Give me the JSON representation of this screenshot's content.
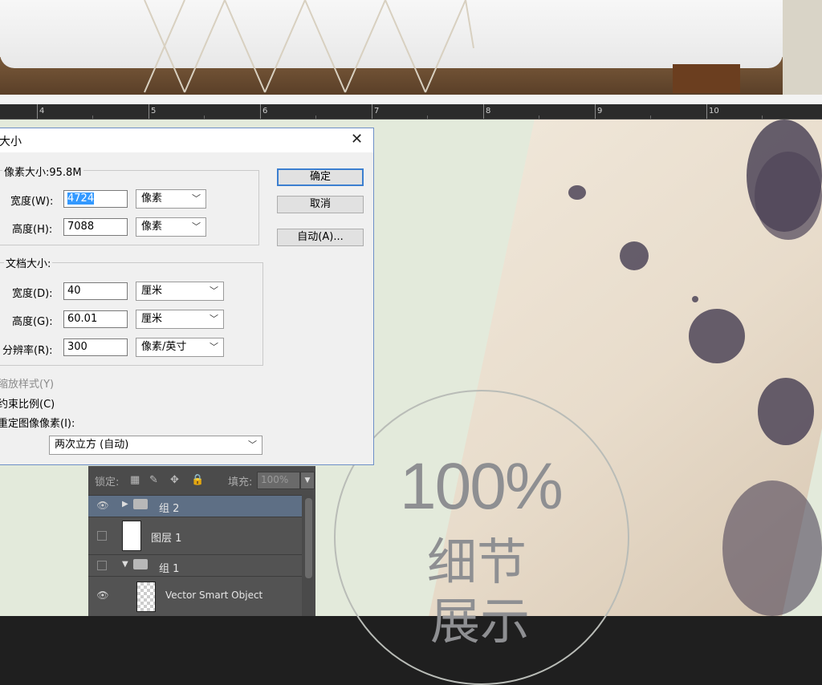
{
  "ruler": {
    "labels": [
      "4",
      "5",
      "6",
      "7",
      "8",
      "9",
      "10"
    ]
  },
  "dialog": {
    "title": "大小",
    "pixel_group_label": "像素大小:95.8M",
    "width_label": "宽度(W):",
    "width_value": "4724",
    "width_unit": "像素",
    "height_label": "高度(H):",
    "height_value": "7088",
    "height_unit": "像素",
    "doc_group_label": "文档大小:",
    "doc_width_label": "宽度(D):",
    "doc_width_value": "40",
    "doc_width_unit": "厘米",
    "doc_height_label": "高度(G):",
    "doc_height_value": "60.01",
    "doc_height_unit": "厘米",
    "resolution_label": "分辨率(R):",
    "resolution_value": "300",
    "resolution_unit": "像素/英寸",
    "scale_styles": "缩放样式(Y)",
    "constrain": "约束比例(C)",
    "resample": "重定图像像素(I):",
    "resample_method": "两次立方 (自动)",
    "ok": "确定",
    "cancel": "取消",
    "auto": "自动(A)..."
  },
  "canvas": {
    "big_text": "100%",
    "detail_text": "细节",
    "detail_text2": "展示"
  },
  "layers": {
    "lock_label": "锁定:",
    "fill_label": "填充:",
    "fill_value": "100%",
    "rows": [
      {
        "name": "组 2"
      },
      {
        "name": "图层 1"
      },
      {
        "name": "组 1"
      },
      {
        "name": "Vector Smart Object"
      }
    ]
  }
}
